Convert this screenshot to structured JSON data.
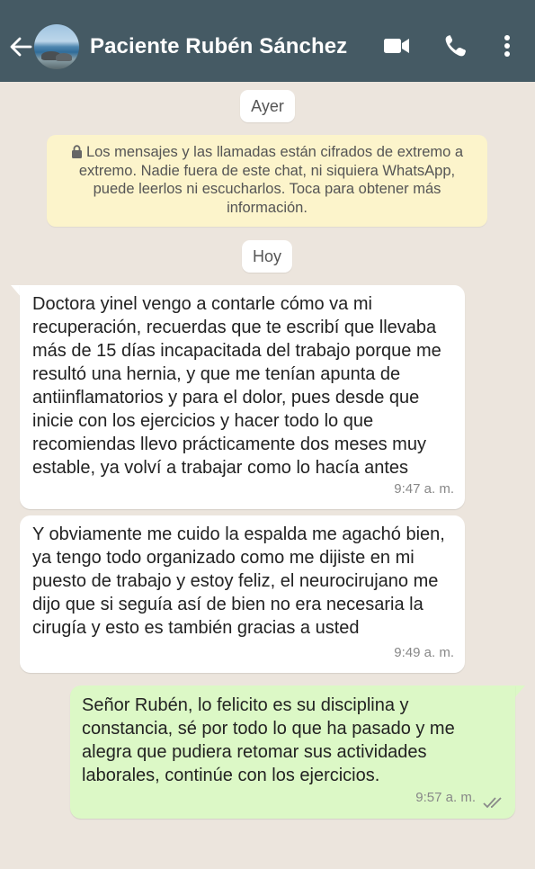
{
  "header": {
    "contact_name": "Paciente Rubén Sánchez",
    "icons": [
      "back-arrow-icon",
      "video-call-icon",
      "voice-call-icon",
      "more-options-icon"
    ],
    "background": "#455A64"
  },
  "chat": {
    "date_yesterday": "Ayer",
    "date_today": "Hoy",
    "encryption_notice": "Los mensajes y las llamadas están cifrados de extremo a extremo. Nadie fuera de este chat, ni siquiera WhatsApp, puede leerlos ni escucharlos. Toca para obtener más información.",
    "messages": [
      {
        "direction": "incoming",
        "text": "Doctora yinel vengo a contarle cómo va mi recuperación, recuerdas que te escribí que llevaba más de 15 días incapacitada del trabajo porque me resultó una hernia, y que me tenían apunta de antiinflamatorios y para el dolor, pues desde que inicie con los ejercicios y hacer todo lo que recomiendas llevo prácticamente dos meses muy estable, ya volví a trabajar como lo hacía antes",
        "time": "9:47 a. m."
      },
      {
        "direction": "incoming",
        "text": "Y obviamente me cuido la espalda me agachó bien, ya tengo todo organizado como me dijiste en mi puesto de trabajo y estoy feliz, el neurocirujano me dijo que si seguía así de bien no era necesaria la cirugía y esto es también gracias a usted",
        "time": "9:49 a. m."
      },
      {
        "direction": "outgoing",
        "text": "Señor Rubén, lo felicito es su disciplina y constancia, sé por todo lo que ha pasado y me alegra que pudiera retomar sus actividades laborales, continúe con los ejercicios.",
        "time": "9:57 a. m.",
        "status": "read"
      }
    ],
    "colors": {
      "wallpaper": "#ECE5DD",
      "outgoing_bubble": "#DCF8C6",
      "incoming_bubble": "#FFFFFF",
      "notice_bubble": "#FCF4CB"
    }
  }
}
